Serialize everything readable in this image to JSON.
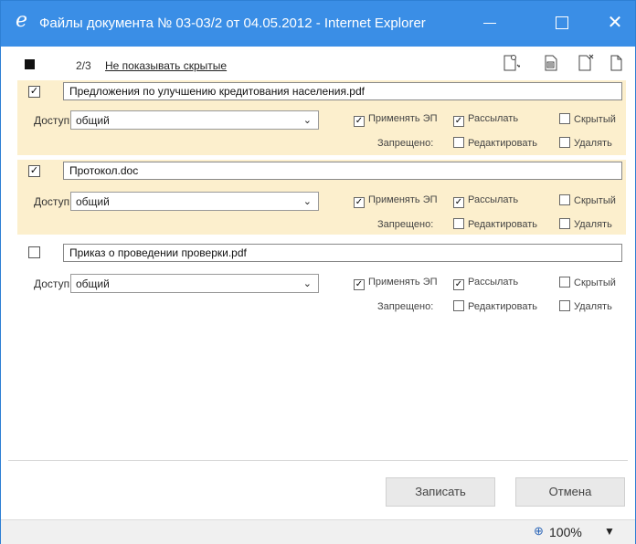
{
  "window": {
    "title": "Файлы документа № 03-03/2 от 04.05.2012 - Internet Explorer",
    "logo_glyph": "e",
    "min_icon": "minimize-icon",
    "max_icon": "maximize-icon",
    "close_glyph": "✕"
  },
  "toolbar": {
    "count": "2/3",
    "hide_link": "Не показывать скрытые",
    "tools": [
      "add-file-icon",
      "scan-icon",
      "delete-file-icon",
      "copy-file-icon"
    ]
  },
  "files": [
    {
      "name": "Предложения по улучшению кредитования населения.pdf",
      "checked": true,
      "access_label": "Доступ:",
      "access_value": "общий",
      "apply_ep": "Применять ЭП",
      "send": "Рассылать",
      "hidden": "Скрытый",
      "forbidden": "Запрещено:",
      "edit": "Редактировать",
      "delete": "Удалять"
    },
    {
      "name": "Протокол.doc",
      "checked": true,
      "access_label": "Доступ:",
      "access_value": "общий",
      "apply_ep": "Применять ЭП",
      "send": "Рассылать",
      "hidden": "Скрытый",
      "forbidden": "Запрещено:",
      "edit": "Редактировать",
      "delete": "Удалять"
    },
    {
      "name": "Приказ о проведении проверки.pdf",
      "checked": false,
      "access_label": "Доступ:",
      "access_value": "общий",
      "apply_ep": "Применять ЭП",
      "send": "Рассылать",
      "hidden": "Скрытый",
      "forbidden": "Запрещено:",
      "edit": "Редактировать",
      "delete": "Удалять"
    }
  ],
  "buttons": {
    "save": "Записать",
    "cancel": "Отмена"
  },
  "status": {
    "zoom": "100%",
    "zoom_icon": "zoom-icon"
  },
  "colors": {
    "titlebar": "#3a8ee6",
    "selected_row": "#fcefcd"
  }
}
